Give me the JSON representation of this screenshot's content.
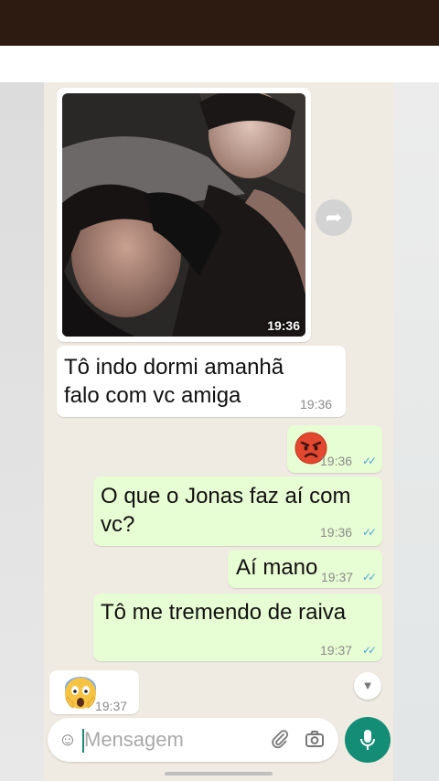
{
  "chat": {
    "photo_message": {
      "time": "19:36"
    },
    "incoming_text": {
      "line1": "Tô indo dormi amanhã",
      "line2": "falo com vc amiga",
      "time": "19:36"
    },
    "outgoing": [
      {
        "kind": "emoji",
        "emoji": "angry-face",
        "time": "19:36"
      },
      {
        "kind": "text",
        "line1": "O que o Jonas faz aí com",
        "line2": "vc?",
        "time": "19:36"
      },
      {
        "kind": "text",
        "line1": "Aí mano",
        "time": "19:37"
      },
      {
        "kind": "text",
        "line1": "Tô me tremendo de raiva",
        "time": "19:37"
      }
    ],
    "incoming_emoji": {
      "emoji": "screaming-face",
      "time": "19:37"
    }
  },
  "composer": {
    "placeholder": "Mensagem",
    "value": "",
    "icons": [
      "emoji-icon",
      "attach-icon",
      "camera-icon",
      "mic-icon"
    ]
  },
  "colors": {
    "outgoing_bubble": "#e7fdd3",
    "incoming_bubble": "#ffffff",
    "accent": "#138d75",
    "read_ticks": "#4fa6e0"
  }
}
